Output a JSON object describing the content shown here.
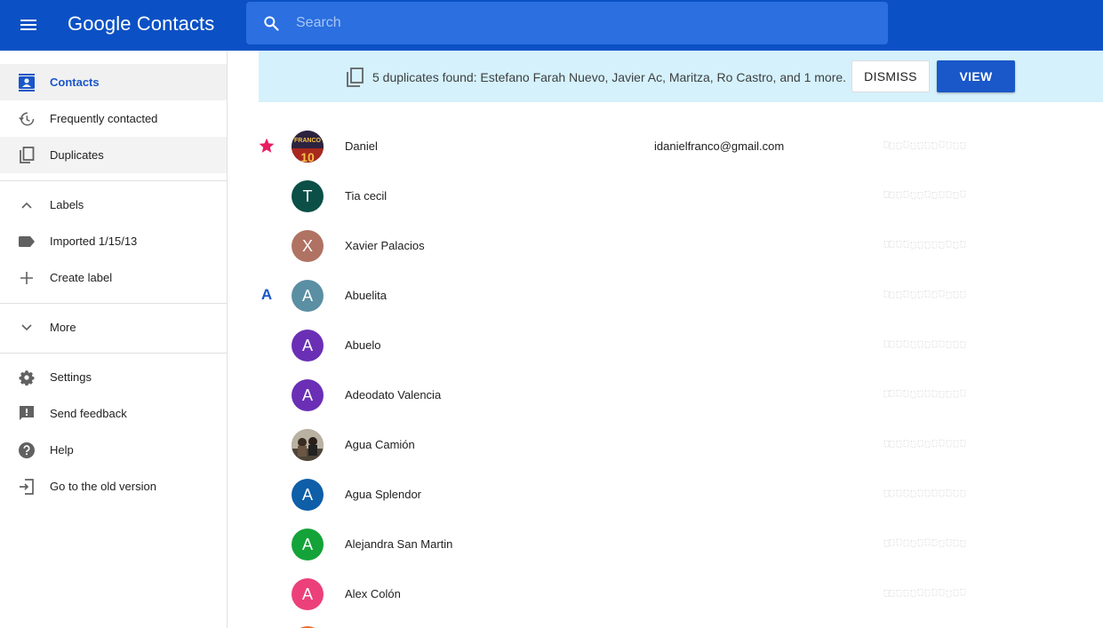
{
  "header": {
    "logo": "Google Contacts",
    "search_placeholder": "Search"
  },
  "colors": {
    "header_bg": "#0b51c5",
    "accent": "#1a57c8",
    "banner_bg": "#d5f1fb",
    "star": "#e91e63"
  },
  "sidebar": {
    "contacts": "Contacts",
    "frequently_contacted": "Frequently contacted",
    "duplicates": "Duplicates",
    "labels": "Labels",
    "imported": "Imported 1/15/13",
    "create_label": "Create label",
    "more": "More",
    "settings": "Settings",
    "send_feedback": "Send feedback",
    "help": "Help",
    "old_version": "Go to the old version"
  },
  "banner": {
    "message": "5 duplicates found: Estefano Farah Nuevo, Javier Ac, Maritza, Ro Castro, and 1 more.",
    "dismiss": "DISMISS",
    "view": "VIEW"
  },
  "contacts": [
    {
      "name": "Daniel",
      "email": "idanielfranco@gmail.com",
      "starred": true,
      "avatar": "photo-franco",
      "avatar_color": "#3a2a1a"
    },
    {
      "name": "Tia cecil",
      "email": "",
      "initial": "T",
      "avatar_color": "#0b4f47"
    },
    {
      "name": "Xavier Palacios",
      "email": "",
      "initial": "X",
      "avatar_color": "#b07263"
    },
    {
      "name": "Abuelita",
      "email": "",
      "initial": "A",
      "avatar_color": "#5b8fa3",
      "section": "A"
    },
    {
      "name": "Abuelo",
      "email": "",
      "initial": "A",
      "avatar_color": "#6a2fb5"
    },
    {
      "name": "Adeodato Valencia",
      "email": "",
      "initial": "A",
      "avatar_color": "#6a2fb5"
    },
    {
      "name": "Agua Camión",
      "email": "",
      "avatar": "photo-people",
      "avatar_color": "#8a7560"
    },
    {
      "name": "Agua Splendor",
      "email": "",
      "initial": "A",
      "avatar_color": "#0e5ea8"
    },
    {
      "name": "Alejandra San Martin",
      "email": "",
      "initial": "A",
      "avatar_color": "#14a338"
    },
    {
      "name": "Alex Colón",
      "email": "",
      "initial": "A",
      "avatar_color": "#ec407a"
    }
  ]
}
